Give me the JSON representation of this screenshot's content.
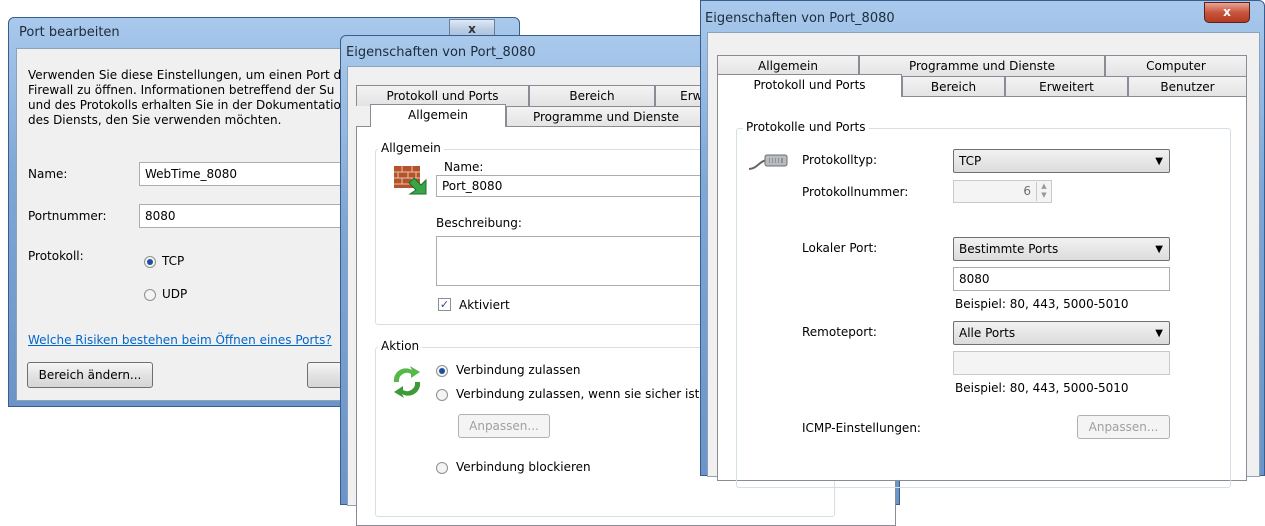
{
  "win1": {
    "title": "Port bearbeiten",
    "close_label": "x",
    "desc_lines": [
      "Verwenden Sie diese Einstellungen, um einen Port d",
      "Firewall zu öffnen. Informationen betreffend der Su",
      "und des Protokolls erhalten Sie in der Dokumentatio",
      "des Diensts, den Sie verwenden möchten."
    ],
    "name_label": "Name:",
    "name_value": "WebTime_8080",
    "port_label": "Portnummer:",
    "port_value": "8080",
    "protocol_label": "Protokoll:",
    "tcp_label": "TCP",
    "udp_label": "UDP",
    "risk_link": "Welche Risiken bestehen beim Öffnen eines Ports?",
    "scope_button": "Bereich ändern...",
    "ok_button_partial": "("
  },
  "win2": {
    "title": "Eigenschaften von Port_8080",
    "tabs_back": [
      "Protokoll und Ports",
      "Bereich",
      "Erwe"
    ],
    "tabs_front": [
      "Allgemein",
      "Programme und Dienste"
    ],
    "group_general": "Allgemein",
    "name_label": "Name:",
    "name_value": "Port_8080",
    "desc_label": "Beschreibung:",
    "enabled_label": "Aktiviert",
    "group_action": "Aktion",
    "opt_allow": "Verbindung zulassen",
    "opt_allow_secure": "Verbindung zulassen, wenn sie sicher ist",
    "customize_button": "Anpassen...",
    "opt_block": "Verbindung blockieren"
  },
  "win3": {
    "title": "Eigenschaften von Port_8080",
    "close_label": "x",
    "tabs_back": [
      "Allgemein",
      "Programme und Dienste",
      "Computer"
    ],
    "tabs_front": [
      "Protokoll und Ports",
      "Bereich",
      "Erweitert",
      "Benutzer"
    ],
    "group": "Protokolle und Ports",
    "protocol_type_label": "Protokolltyp:",
    "protocol_type_value": "TCP",
    "protocol_number_label": "Protokollnummer:",
    "protocol_number_value": "6",
    "local_port_label": "Lokaler Port:",
    "local_port_value": "Bestimmte Ports",
    "local_port_input": "8080",
    "local_example": "Beispiel: 80, 443, 5000-5010",
    "remote_port_label": "Remoteport:",
    "remote_port_value": "Alle Ports",
    "remote_example": "Beispiel: 80, 443, 5000-5010",
    "icmp_label": "ICMP-Einstellungen:",
    "customize_button": "Anpassen..."
  }
}
